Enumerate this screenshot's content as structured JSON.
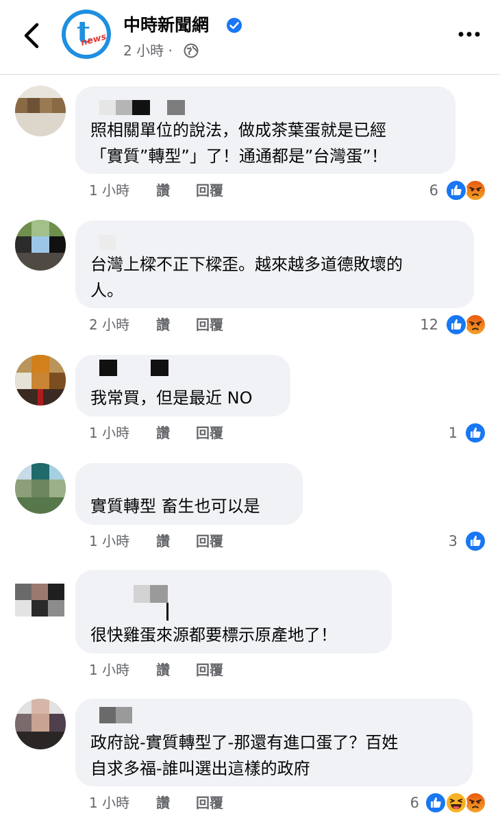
{
  "header": {
    "page_name": "中時新聞網",
    "post_time": "2 小時 ·",
    "logo_news": "news",
    "logo_t": "t",
    "colors": {
      "brand_blue": "#1f8fe0",
      "verified": "#1877f2"
    }
  },
  "comments": [
    {
      "text_lines": [
        "照相關單位的說法，做成茶葉蛋就是已經",
        "「實質”轉型”」了！通通都是”台灣蛋”！"
      ],
      "time": "1 小時",
      "like_label": "讚",
      "reply_label": "回覆",
      "reaction_count": "6",
      "reactions": [
        "like-icon",
        "angry-icon"
      ]
    },
    {
      "text_lines": [
        "台灣上樑不正下樑歪。越來越多道德敗壞的",
        "人。"
      ],
      "time": "2 小時",
      "like_label": "讚",
      "reply_label": "回覆",
      "reaction_count": "12",
      "reactions": [
        "like-icon",
        "angry-icon"
      ]
    },
    {
      "text_lines": [
        "我常買，但是最近 NO"
      ],
      "time": "1 小時",
      "like_label": "讚",
      "reply_label": "回覆",
      "reaction_count": "1",
      "reactions": [
        "like-icon"
      ]
    },
    {
      "text_lines": [
        "實質轉型 畜生也可以是"
      ],
      "time": "1 小時",
      "like_label": "讚",
      "reply_label": "回覆",
      "reaction_count": "3",
      "reactions": [
        "like-icon"
      ]
    },
    {
      "text_lines": [
        "很快雞蛋來源都要標示原產地了！"
      ],
      "time": "1 小時",
      "like_label": "讚",
      "reply_label": "回覆",
      "reaction_count": "",
      "reactions": []
    },
    {
      "text_lines": [
        "政府說-實質轉型了-那還有進口蛋了？百姓",
        "自求多福-誰叫選出這樣的政府"
      ],
      "time": "1 小時",
      "like_label": "讚",
      "reply_label": "回覆",
      "reaction_count": "6",
      "reactions": [
        "like-icon",
        "haha-icon",
        "angry-icon"
      ]
    }
  ]
}
